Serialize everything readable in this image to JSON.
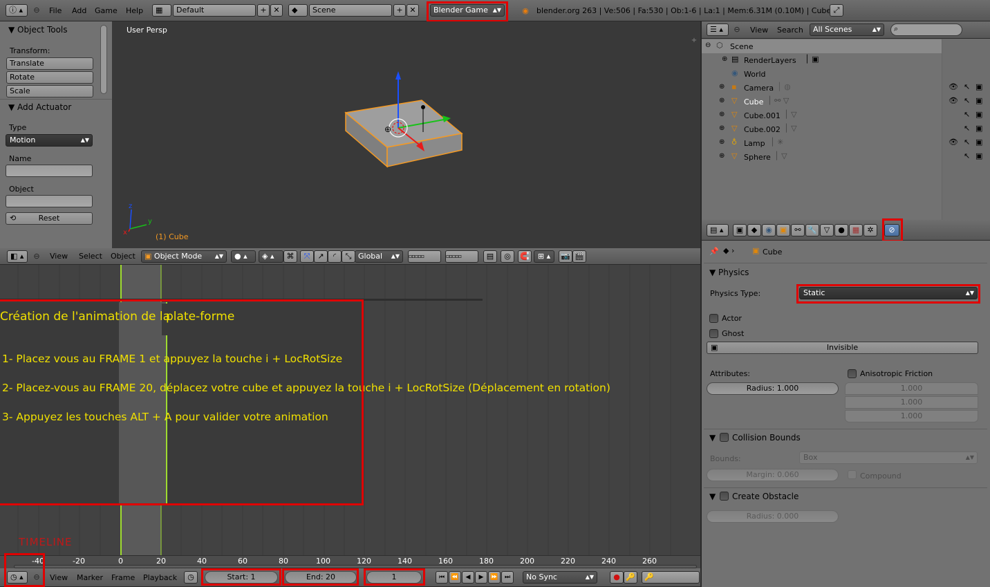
{
  "topbar": {
    "menus": [
      "File",
      "Add",
      "Game",
      "Help"
    ],
    "layout": "Default",
    "scene": "Scene",
    "engine": "Blender Game",
    "stats": "blender.org 263 | Ve:506 | Fa:530 | Ob:1-6 | La:1 | Mem:6.31M (0.10M) | Cube"
  },
  "tools": {
    "title": "Object Tools",
    "transform_label": "Transform:",
    "buttons": [
      "Translate",
      "Rotate",
      "Scale"
    ],
    "actuator_title": "Add Actuator",
    "type_label": "Type",
    "type_value": "Motion",
    "name_label": "Name",
    "object_label": "Object",
    "reset": "Reset"
  },
  "viewport": {
    "view_name": "User Persp",
    "object_label": "(1) Cube",
    "axis_y": "y",
    "axis_z": "z",
    "axis_x": "x"
  },
  "view3d_header": {
    "menus": [
      "View",
      "Select",
      "Object"
    ],
    "mode": "Object Mode",
    "orientation": "Global"
  },
  "timeline_overlay": {
    "title_left": "Création de l'animation de la",
    "title_right": "plate-forme",
    "steps": [
      "1- Placez vous au FRAME 1 et appuyez la touche i + LocRotSize",
      "2- Placez-vous au FRAME 20, déplacez votre cube et appuyez la touche i + LocRotSize (Déplacement en rotation)",
      "3- Appuyez les touches ALT + A pour valider votre animation"
    ],
    "label": "TIMELINE"
  },
  "timeline": {
    "ticks": [
      "-40",
      "-20",
      "0",
      "20",
      "40",
      "60",
      "80",
      "100",
      "120",
      "140",
      "160",
      "180",
      "200",
      "220",
      "240",
      "260"
    ],
    "menus": [
      "View",
      "Marker",
      "Frame",
      "Playback"
    ],
    "start": "Start: 1",
    "end": "End: 20",
    "current": "1",
    "sync": "No Sync"
  },
  "outliner": {
    "menus": [
      "View",
      "Search"
    ],
    "scenes": "All Scenes",
    "items": [
      {
        "name": "Scene",
        "indent": 0
      },
      {
        "name": "RenderLayers",
        "indent": 1
      },
      {
        "name": "World",
        "indent": 1
      },
      {
        "name": "Camera",
        "indent": 1
      },
      {
        "name": "Cube",
        "indent": 1
      },
      {
        "name": "Cube.001",
        "indent": 1
      },
      {
        "name": "Cube.002",
        "indent": 1
      },
      {
        "name": "Lamp",
        "indent": 1
      },
      {
        "name": "Sphere",
        "indent": 1
      }
    ]
  },
  "properties": {
    "breadcrumb": "Cube",
    "physics_title": "Physics",
    "physics_type_label": "Physics Type:",
    "physics_type": "Static",
    "actor": "Actor",
    "ghost": "Ghost",
    "invisible": "Invisible",
    "attributes": "Attributes:",
    "radius": "Radius: 1.000",
    "aniso": "Anisotropic Friction",
    "aniso_vals": [
      "1.000",
      "1.000",
      "1.000"
    ],
    "collision": "Collision Bounds",
    "bounds_label": "Bounds:",
    "bounds_value": "Box",
    "margin": "Margin: 0.060",
    "compound": "Compound",
    "obstacle": "Create Obstacle",
    "obstacle_radius": "Radius: 0.000"
  },
  "colors": {
    "accent_red": "#e00000",
    "overlay_yellow": "#f0e000",
    "selected_orange": "#f59a23",
    "frame_green": "#9fdc2f"
  }
}
